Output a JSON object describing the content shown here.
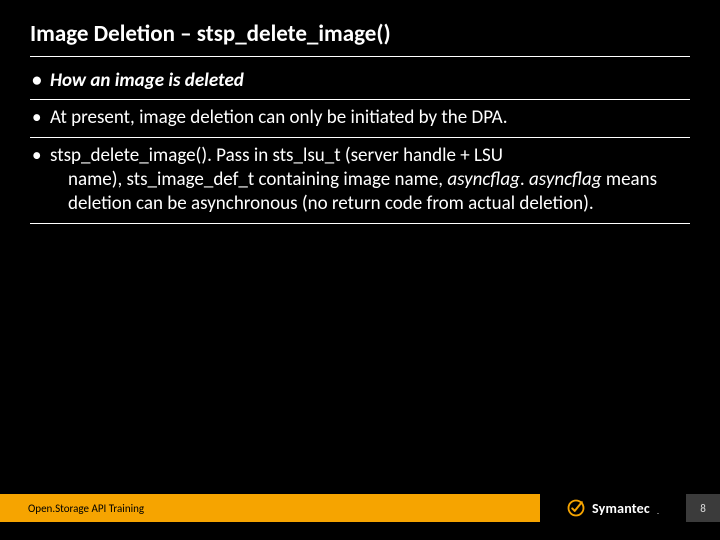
{
  "slide": {
    "title": "Image Deletion – stsp_delete_image()",
    "bullets": {
      "b1": "How an image is deleted",
      "b2": "At present, image deletion can only be initiated by the DPA.",
      "b3": {
        "a": "stsp_delete_image(). Pass in sts_lsu_t (server handle + LSU ",
        "b": "name), sts_image_def_t containing image name, ",
        "c": "asyncflag",
        "d": ". ",
        "e": "asyncflag",
        "f": " means deletion can be asynchronous (no return code ",
        "g": "from actual deletion)."
      }
    }
  },
  "footer": {
    "label": "Open.Storage API Training",
    "logo_text": "Symantec",
    "tm": ".",
    "page": "8"
  },
  "colors": {
    "accent": "#f6a400"
  }
}
